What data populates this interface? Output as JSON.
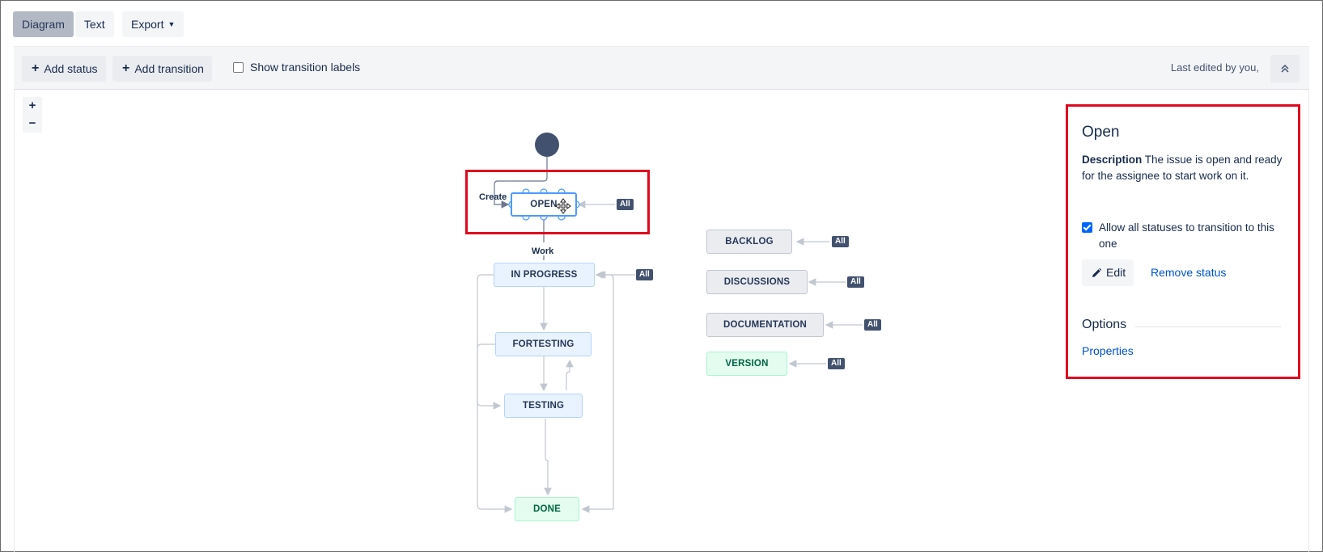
{
  "view_tabs": [
    {
      "label": "Diagram",
      "active": true
    },
    {
      "label": "Text",
      "active": false
    }
  ],
  "export": {
    "label": "Export"
  },
  "toolbar": {
    "add_status": "Add status",
    "add_transition": "Add transition",
    "show_labels": "Show transition labels",
    "show_labels_checked": false,
    "last_edited": "Last edited by you,"
  },
  "zoom": {
    "in": "+",
    "out": "−"
  },
  "statuses": {
    "open": "OPEN",
    "in_progress": "IN PROGRESS",
    "fortesting": "FORTESTING",
    "testing": "TESTING",
    "done": "DONE",
    "backlog": "BACKLOG",
    "discussions": "DISCUSSIONS",
    "documentation": "DOCUMENTATION",
    "version": "VERSION"
  },
  "transitions": {
    "create": "Create",
    "work": "Work",
    "all": "All"
  },
  "panel": {
    "title": "Open",
    "description_label": "Description",
    "description_text": "The issue is open and ready for the assignee to start work on it.",
    "allow_all_label": "Allow all statuses to transition to this one",
    "allow_all_checked": true,
    "edit_label": "Edit",
    "remove_label": "Remove status",
    "options_title": "Options",
    "properties_label": "Properties"
  },
  "colors": {
    "highlight": "#e0081e",
    "link": "#0052cc",
    "selected_border": "#4c9aff"
  }
}
